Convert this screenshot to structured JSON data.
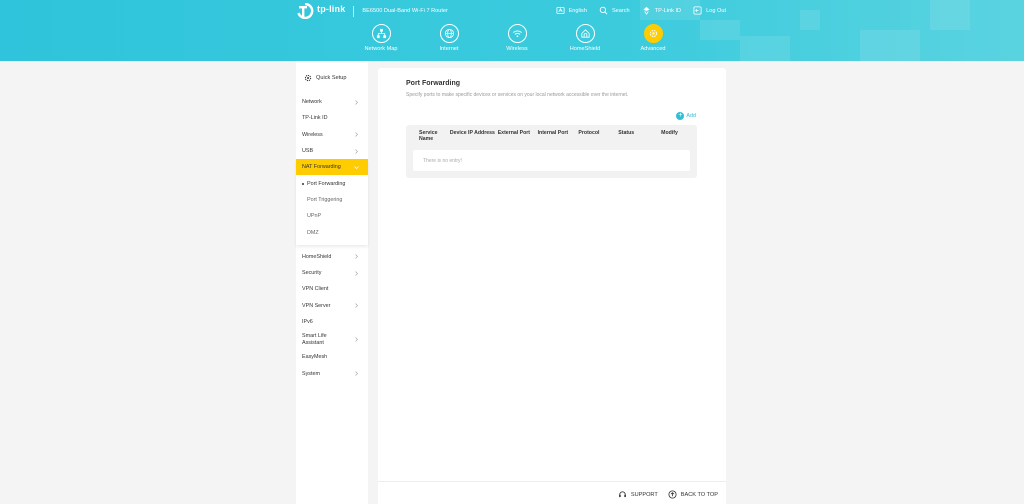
{
  "header": {
    "brand": "tp-link",
    "model": "BE6500 Dual-Band Wi-Fi 7 Router",
    "links": [
      {
        "icon": "language-icon",
        "label": "English"
      },
      {
        "icon": "search-icon",
        "label": "Search"
      },
      {
        "icon": "cloud-user-icon",
        "label": "TP-Link ID"
      },
      {
        "icon": "logout-icon",
        "label": "Log Out"
      }
    ],
    "tabs": [
      {
        "icon": "network-map-icon",
        "label": "Network Map"
      },
      {
        "icon": "internet-globe-icon",
        "label": "Internet"
      },
      {
        "icon": "wireless-icon",
        "label": "Wireless"
      },
      {
        "icon": "homeshield-icon",
        "label": "HomeShield"
      },
      {
        "icon": "advanced-gear-icon",
        "label": "Advanced"
      }
    ],
    "active_tab": "Advanced",
    "accent": "#ffcc00",
    "brand_color": "#2fc4db"
  },
  "sidebar": {
    "quick_setup": "Quick Setup",
    "items": [
      {
        "label": "Network"
      },
      {
        "label": "TP-Link ID"
      },
      {
        "label": "Wireless"
      },
      {
        "label": "USB"
      },
      {
        "label": "NAT Forwarding"
      },
      {
        "label": "HomeShield"
      },
      {
        "label": "Security"
      },
      {
        "label": "VPN Client"
      },
      {
        "label": "VPN Server"
      },
      {
        "label": "IPv6"
      },
      {
        "label": "Smart Life Assistant"
      },
      {
        "label": "EasyMesh"
      },
      {
        "label": "System"
      }
    ],
    "sub_items": [
      {
        "label": "Port Forwarding"
      },
      {
        "label": "Port Triggering"
      },
      {
        "label": "UPnP"
      },
      {
        "label": "DMZ"
      }
    ]
  },
  "main": {
    "title": "Port Forwarding",
    "description": "Specify ports to make specific devices or services on your local network accessible over the internet.",
    "add_label": "Add",
    "columns": [
      "Service Name",
      "Device IP Address",
      "External Port",
      "Internal Port",
      "Protocol",
      "Status",
      "Modify"
    ],
    "empty_text": "There is no entry!"
  },
  "footer": {
    "support": "SUPPORT",
    "back_to_top": "BACK TO TOP"
  }
}
